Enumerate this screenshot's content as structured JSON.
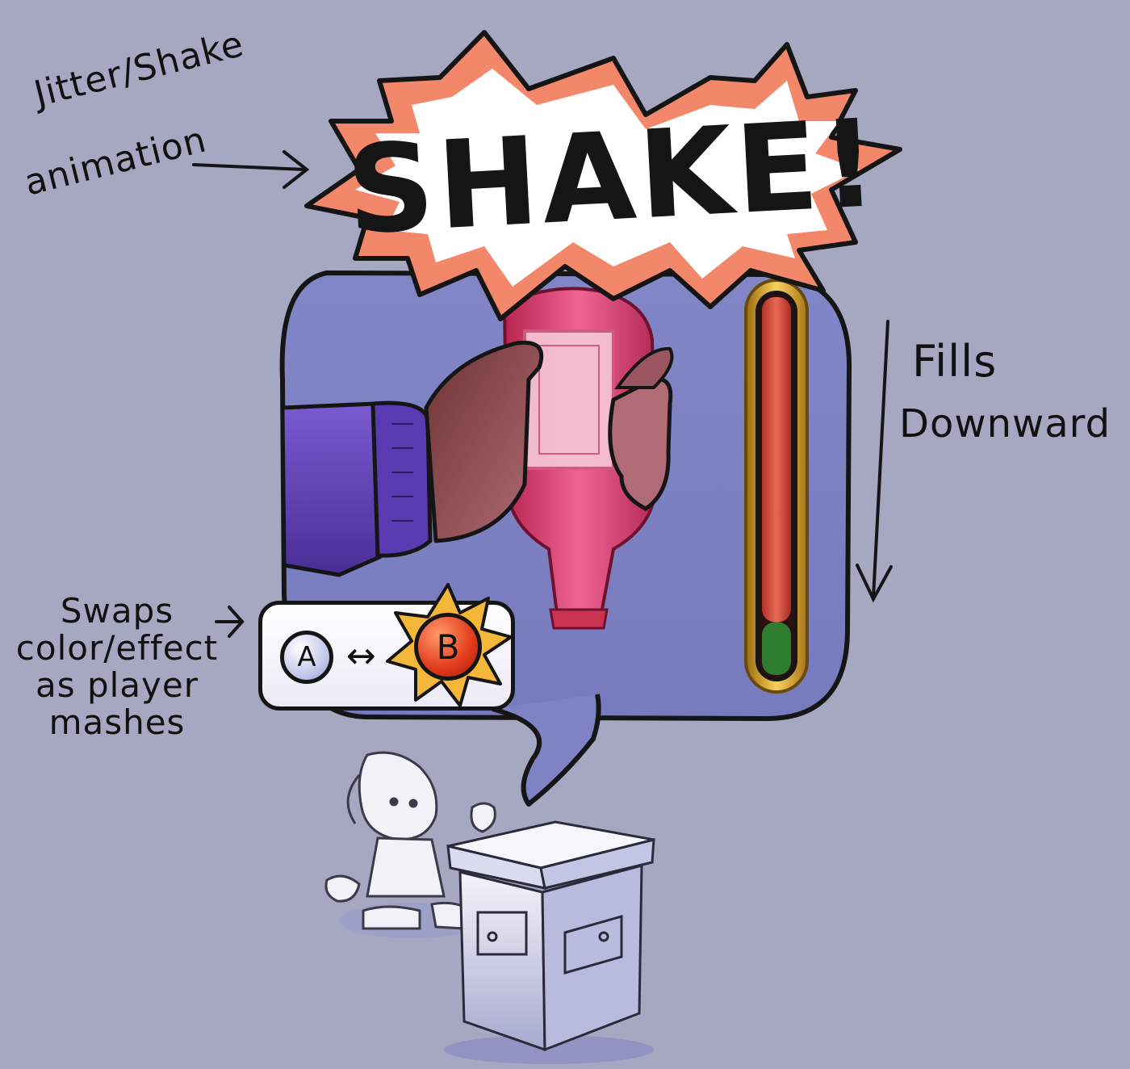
{
  "annotations": {
    "jitter_line1": "Jitter/Shake",
    "jitter_line2": "animation",
    "fills_line1": "Fills",
    "fills_line2": "Downward",
    "swap_lines": [
      "Swaps",
      "color/effect",
      "as player",
      "mashes"
    ]
  },
  "burst": {
    "text": "SHAKE!"
  },
  "buttons": {
    "a_label": "A",
    "b_label": "B",
    "swap_glyph": "↔"
  },
  "meter": {
    "fill_fraction": 0.86,
    "fill_color": "#d2453b",
    "empty_color": "#2e7d2e"
  },
  "colors": {
    "background": "#a6a7c1",
    "panel": "#7f83c3",
    "burst_outer": "#f3876a",
    "burst_inner": "#ffffff",
    "bottle": "#d93f6c",
    "sleeve": "#5b3ea8",
    "hand": "#7a3b3b",
    "gold": "#e0a521"
  },
  "icons": {
    "burst": "explosion-burst-icon",
    "bottle": "bottle-icon",
    "hand": "hand-icon",
    "character": "character-icon",
    "box": "crate-icon"
  }
}
